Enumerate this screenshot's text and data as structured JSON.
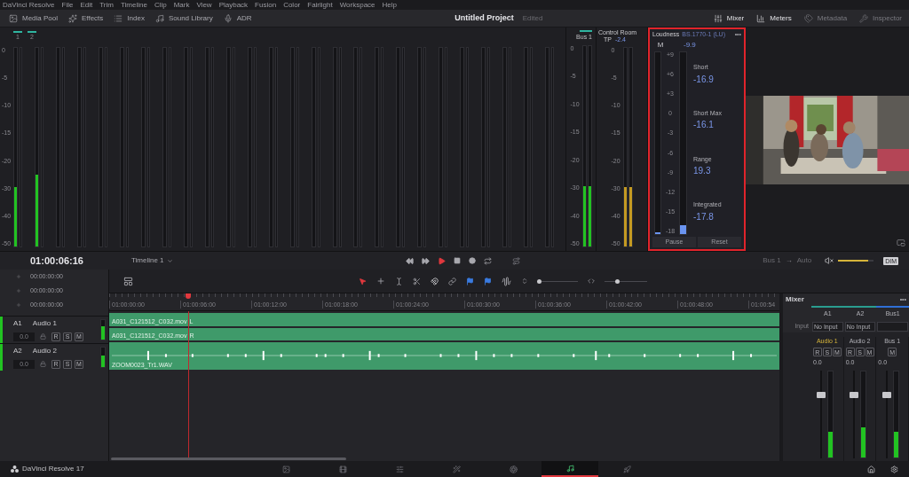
{
  "menu_bar": {
    "app": "DaVinci Resolve",
    "items": [
      "File",
      "Edit",
      "Trim",
      "Timeline",
      "Clip",
      "Mark",
      "View",
      "Playback",
      "Fusion",
      "Color",
      "Fairlight",
      "Workspace",
      "Help"
    ]
  },
  "toolbar": {
    "left": [
      "Media Pool",
      "Effects",
      "Index",
      "Sound Library",
      "ADR"
    ],
    "project_title": "Untitled Project",
    "project_status": "Edited",
    "right": [
      {
        "label": "Mixer",
        "selected": true
      },
      {
        "label": "Meters",
        "selected": true
      },
      {
        "label": "Metadata",
        "selected": false
      },
      {
        "label": "Inspector",
        "selected": false
      }
    ]
  },
  "track_meters": {
    "channel_labels": [
      "1",
      "2"
    ],
    "scale": [
      "0",
      "-5",
      "-10",
      "-15",
      "-20",
      "-30",
      "-40",
      "-50"
    ],
    "meters": [
      {
        "level": 0.3
      },
      {
        "level": 0.36
      }
    ]
  },
  "bus_meter": {
    "title": "Bus 1",
    "scale": [
      "0",
      "-5",
      "-10",
      "-15",
      "-20",
      "-30",
      "-40",
      "-50"
    ],
    "meters": [
      {
        "level": 0.3
      },
      {
        "level": 0.3
      }
    ]
  },
  "control_room": {
    "title": "Control Room",
    "tp_label": "TP",
    "tp_value": "-2.4",
    "scale": [
      "0",
      "-5",
      "-10",
      "-15",
      "-20",
      "-30",
      "-40",
      "-50"
    ],
    "meters": [
      {
        "level": 0.3
      },
      {
        "level": 0.3
      }
    ]
  },
  "loudness": {
    "title": "Loudness",
    "standard": "BS.1770-1 (LU)",
    "menu": "•••",
    "m_label": "M",
    "m_value": "-9.9",
    "scale": [
      "+9",
      "+6",
      "+3",
      "0",
      "-3",
      "-6",
      "-9",
      "-12",
      "-15",
      "-18"
    ],
    "meters": [
      {
        "level": 0.01
      },
      {
        "level": 0.05
      }
    ],
    "readings": [
      {
        "label": "Short",
        "value": "-16.9"
      },
      {
        "label": "Short Max",
        "value": "-16.1"
      },
      {
        "label": "Range",
        "value": "19.3"
      },
      {
        "label": "Integrated",
        "value": "-17.8"
      }
    ],
    "buttons": [
      "Pause",
      "Reset"
    ]
  },
  "transport": {
    "timecode": "01:00:06:16",
    "timeline": "Timeline 1",
    "bus": "Bus 1",
    "arrow": "→",
    "mode": "Auto",
    "volume": {
      "level": 0.85
    },
    "dim": "DIM"
  },
  "timecodes": [
    "00:00:00:00",
    "00:00:00:00",
    "00:00:00:00"
  ],
  "zoom_sliders": [
    {
      "level": 0.02
    },
    {
      "level": 0.3
    }
  ],
  "ruler": [
    "01:00:00:00",
    "01:00:06:00",
    "01:00:12:00",
    "01:00:18:00",
    "01:00:24:00",
    "01:00:30:00",
    "01:00:36:00",
    "01:00:42:00",
    "01:00:48:00",
    "01:00:54"
  ],
  "tracks": [
    {
      "id": "A1",
      "name": "Audio 1",
      "volume": "0.0",
      "buttons": [
        "R",
        "S",
        "M"
      ],
      "level": 0.7,
      "clips": [
        {
          "name": "A031_C121512_C032.mov",
          "channel": "L"
        },
        {
          "name": "A031_C121512_C032.mov",
          "channel": "R"
        }
      ]
    },
    {
      "id": "A2",
      "name": "Audio 2",
      "volume": "0.0",
      "buttons": [
        "R",
        "S",
        "M"
      ],
      "level": 0.6,
      "clips": [
        {
          "name": "ZOOM0023_Tr1.WAV",
          "kind": "waveform"
        }
      ]
    }
  ],
  "mixer": {
    "title": "Mixer",
    "menu": "•••",
    "columns": [
      {
        "label": "A1",
        "color": "#2a9d8f"
      },
      {
        "label": "A2",
        "color": "#2a9d8f"
      },
      {
        "label": "Bus1",
        "color": "#2f6fd6"
      }
    ],
    "input_label": "Input",
    "inputs": [
      "No Input",
      "No Input"
    ],
    "strips": [
      {
        "name": "Audio 1",
        "selected": true,
        "buttons": [
          "R",
          "S",
          "M"
        ],
        "gain": "0.0",
        "fader": {
          "level": 0.72
        },
        "meter": {
          "level": 0.3
        }
      },
      {
        "name": "Audio 2",
        "selected": false,
        "buttons": [
          "R",
          "S",
          "M"
        ],
        "gain": "0.0",
        "fader": {
          "level": 0.72
        },
        "meter": {
          "level": 0.35
        }
      },
      {
        "name": "Bus 1",
        "selected": false,
        "buttons": [
          "M"
        ],
        "gain": "0.0",
        "fader": {
          "level": 0.72
        },
        "meter": {
          "level": 0.3
        }
      }
    ]
  },
  "bottom_bar": {
    "app": "DaVinci Resolve 17",
    "pages": [
      {
        "selected": false
      },
      {
        "selected": false
      },
      {
        "selected": false
      },
      {
        "selected": false
      },
      {
        "selected": false
      },
      {
        "selected": true
      },
      {
        "selected": false
      }
    ]
  }
}
